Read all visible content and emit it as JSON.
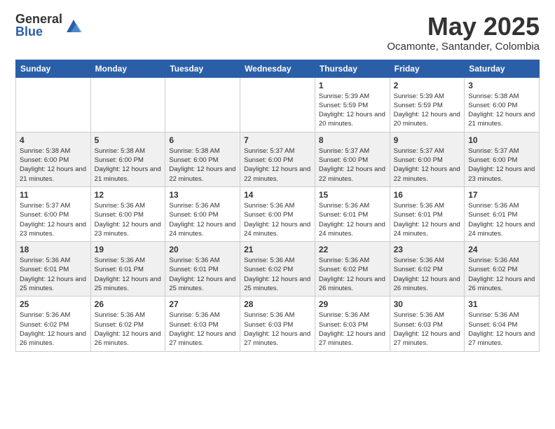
{
  "header": {
    "logo_general": "General",
    "logo_blue": "Blue",
    "month_title": "May 2025",
    "location": "Ocamonte, Santander, Colombia"
  },
  "days_of_week": [
    "Sunday",
    "Monday",
    "Tuesday",
    "Wednesday",
    "Thursday",
    "Friday",
    "Saturday"
  ],
  "weeks": [
    [
      {
        "day": "",
        "content": ""
      },
      {
        "day": "",
        "content": ""
      },
      {
        "day": "",
        "content": ""
      },
      {
        "day": "",
        "content": ""
      },
      {
        "day": "1",
        "content": "Sunrise: 5:39 AM\nSunset: 5:59 PM\nDaylight: 12 hours\nand 20 minutes."
      },
      {
        "day": "2",
        "content": "Sunrise: 5:39 AM\nSunset: 5:59 PM\nDaylight: 12 hours\nand 20 minutes."
      },
      {
        "day": "3",
        "content": "Sunrise: 5:38 AM\nSunset: 6:00 PM\nDaylight: 12 hours\nand 21 minutes."
      }
    ],
    [
      {
        "day": "4",
        "content": "Sunrise: 5:38 AM\nSunset: 6:00 PM\nDaylight: 12 hours\nand 21 minutes."
      },
      {
        "day": "5",
        "content": "Sunrise: 5:38 AM\nSunset: 6:00 PM\nDaylight: 12 hours\nand 21 minutes."
      },
      {
        "day": "6",
        "content": "Sunrise: 5:38 AM\nSunset: 6:00 PM\nDaylight: 12 hours\nand 22 minutes."
      },
      {
        "day": "7",
        "content": "Sunrise: 5:37 AM\nSunset: 6:00 PM\nDaylight: 12 hours\nand 22 minutes."
      },
      {
        "day": "8",
        "content": "Sunrise: 5:37 AM\nSunset: 6:00 PM\nDaylight: 12 hours\nand 22 minutes."
      },
      {
        "day": "9",
        "content": "Sunrise: 5:37 AM\nSunset: 6:00 PM\nDaylight: 12 hours\nand 22 minutes."
      },
      {
        "day": "10",
        "content": "Sunrise: 5:37 AM\nSunset: 6:00 PM\nDaylight: 12 hours\nand 23 minutes."
      }
    ],
    [
      {
        "day": "11",
        "content": "Sunrise: 5:37 AM\nSunset: 6:00 PM\nDaylight: 12 hours\nand 23 minutes."
      },
      {
        "day": "12",
        "content": "Sunrise: 5:36 AM\nSunset: 6:00 PM\nDaylight: 12 hours\nand 23 minutes."
      },
      {
        "day": "13",
        "content": "Sunrise: 5:36 AM\nSunset: 6:00 PM\nDaylight: 12 hours\nand 24 minutes."
      },
      {
        "day": "14",
        "content": "Sunrise: 5:36 AM\nSunset: 6:00 PM\nDaylight: 12 hours\nand 24 minutes."
      },
      {
        "day": "15",
        "content": "Sunrise: 5:36 AM\nSunset: 6:01 PM\nDaylight: 12 hours\nand 24 minutes."
      },
      {
        "day": "16",
        "content": "Sunrise: 5:36 AM\nSunset: 6:01 PM\nDaylight: 12 hours\nand 24 minutes."
      },
      {
        "day": "17",
        "content": "Sunrise: 5:36 AM\nSunset: 6:01 PM\nDaylight: 12 hours\nand 24 minutes."
      }
    ],
    [
      {
        "day": "18",
        "content": "Sunrise: 5:36 AM\nSunset: 6:01 PM\nDaylight: 12 hours\nand 25 minutes."
      },
      {
        "day": "19",
        "content": "Sunrise: 5:36 AM\nSunset: 6:01 PM\nDaylight: 12 hours\nand 25 minutes."
      },
      {
        "day": "20",
        "content": "Sunrise: 5:36 AM\nSunset: 6:01 PM\nDaylight: 12 hours\nand 25 minutes."
      },
      {
        "day": "21",
        "content": "Sunrise: 5:36 AM\nSunset: 6:02 PM\nDaylight: 12 hours\nand 25 minutes."
      },
      {
        "day": "22",
        "content": "Sunrise: 5:36 AM\nSunset: 6:02 PM\nDaylight: 12 hours\nand 26 minutes."
      },
      {
        "day": "23",
        "content": "Sunrise: 5:36 AM\nSunset: 6:02 PM\nDaylight: 12 hours\nand 26 minutes."
      },
      {
        "day": "24",
        "content": "Sunrise: 5:36 AM\nSunset: 6:02 PM\nDaylight: 12 hours\nand 26 minutes."
      }
    ],
    [
      {
        "day": "25",
        "content": "Sunrise: 5:36 AM\nSunset: 6:02 PM\nDaylight: 12 hours\nand 26 minutes."
      },
      {
        "day": "26",
        "content": "Sunrise: 5:36 AM\nSunset: 6:02 PM\nDaylight: 12 hours\nand 26 minutes."
      },
      {
        "day": "27",
        "content": "Sunrise: 5:36 AM\nSunset: 6:03 PM\nDaylight: 12 hours\nand 27 minutes."
      },
      {
        "day": "28",
        "content": "Sunrise: 5:36 AM\nSunset: 6:03 PM\nDaylight: 12 hours\nand 27 minutes."
      },
      {
        "day": "29",
        "content": "Sunrise: 5:36 AM\nSunset: 6:03 PM\nDaylight: 12 hours\nand 27 minutes."
      },
      {
        "day": "30",
        "content": "Sunrise: 5:36 AM\nSunset: 6:03 PM\nDaylight: 12 hours\nand 27 minutes."
      },
      {
        "day": "31",
        "content": "Sunrise: 5:36 AM\nSunset: 6:04 PM\nDaylight: 12 hours\nand 27 minutes."
      }
    ]
  ]
}
